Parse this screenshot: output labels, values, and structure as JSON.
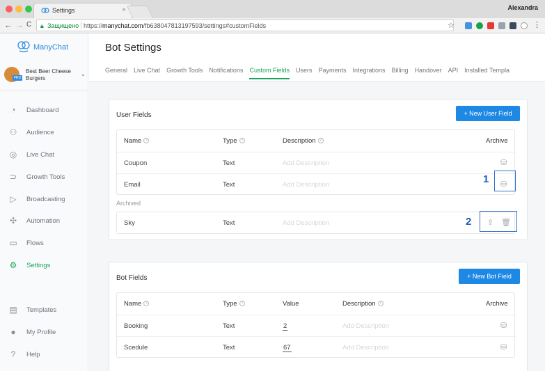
{
  "browser": {
    "tab_title": "Settings",
    "tab_close": "×",
    "user": "Alexandra",
    "secure_label": "Защищено",
    "url_prefix": "https://",
    "url_host": "manychat.com",
    "url_path": "/fb638047813197593/settings#customFields",
    "back_icon": "←",
    "forward_icon": "→",
    "reload_icon": "C",
    "star_icon": "☆"
  },
  "sidebar": {
    "brand": "ManyChat",
    "account_name": "Best Beer Cheese Burgers",
    "account_badge": "PRO",
    "items": [
      {
        "label": "Dashboard",
        "icon": "◔"
      },
      {
        "label": "Audience",
        "icon": "⚇"
      },
      {
        "label": "Live Chat",
        "icon": "◎"
      },
      {
        "label": "Growth Tools",
        "icon": "⊃"
      },
      {
        "label": "Broadcasting",
        "icon": "▷"
      },
      {
        "label": "Automation",
        "icon": "✣"
      },
      {
        "label": "Flows",
        "icon": "▭"
      },
      {
        "label": "Settings",
        "icon": "⚙"
      },
      {
        "label": "Templates",
        "icon": "▤"
      },
      {
        "label": "My Profile",
        "icon": "●"
      },
      {
        "label": "Help",
        "icon": "?"
      }
    ],
    "active_index": 7
  },
  "header": {
    "title": "Bot Settings",
    "tabs": [
      "General",
      "Live Chat",
      "Growth Tools",
      "Notifications",
      "Custom Fields",
      "Users",
      "Payments",
      "Integrations",
      "Billing",
      "Handover",
      "API",
      "Installed Templa"
    ],
    "active_tab": 4
  },
  "user_fields": {
    "title": "User Fields",
    "new_button": "+ New User Field",
    "columns": {
      "name": "Name",
      "type": "Type",
      "description": "Description",
      "archive": "Archive"
    },
    "help_glyph": "?",
    "rows": [
      {
        "name": "Coupon",
        "type": "Text",
        "description": "Add Description"
      },
      {
        "name": "Email",
        "type": "Text",
        "description": "Add Description"
      }
    ],
    "archived_label": "Archived",
    "archived_rows": [
      {
        "name": "Sky",
        "type": "Text",
        "description": "Add Description"
      }
    ]
  },
  "bot_fields": {
    "title": "Bot Fields",
    "new_button": "+ New Bot Field",
    "columns": {
      "name": "Name",
      "type": "Type",
      "value": "Value",
      "description": "Description",
      "archive": "Archive"
    },
    "rows": [
      {
        "name": "Booking",
        "type": "Text",
        "value": "2",
        "description": "Add Description"
      },
      {
        "name": "Scedule",
        "type": "Text",
        "value": "67",
        "description": "Add Description"
      }
    ]
  },
  "callouts": [
    "1",
    "2"
  ],
  "icons": {
    "archive": "⛁",
    "unarchive": "⇪",
    "delete": "🗑"
  },
  "colors": {
    "accent_green": "#1aa35a",
    "primary_blue": "#1e88e5",
    "callout_blue": "#2f6fc9"
  }
}
